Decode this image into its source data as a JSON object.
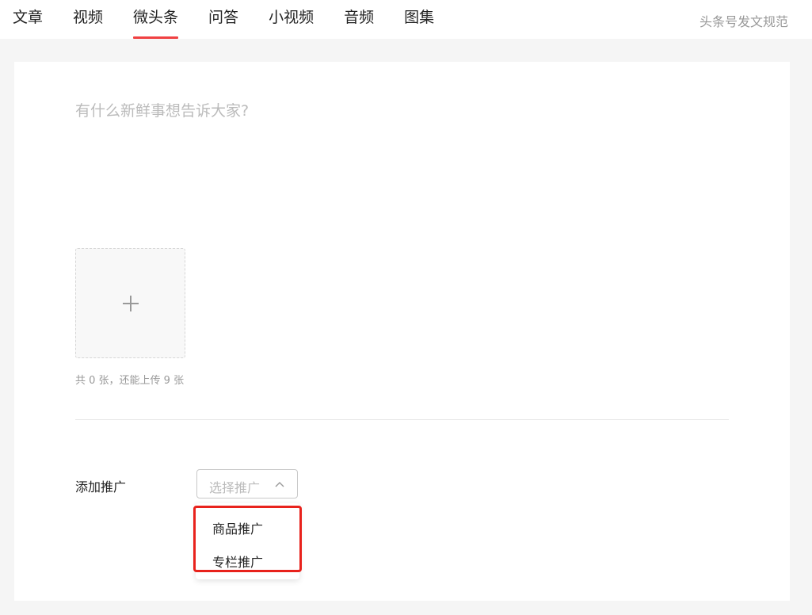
{
  "nav": {
    "tabs": [
      {
        "label": "文章"
      },
      {
        "label": "视频"
      },
      {
        "label": "微头条"
      },
      {
        "label": "问答"
      },
      {
        "label": "小视频"
      },
      {
        "label": "音频"
      },
      {
        "label": "图集"
      }
    ],
    "active_tab": "微头条",
    "guide_link": "头条号发文规范"
  },
  "editor": {
    "placeholder": "有什么新鲜事想告诉大家?"
  },
  "upload": {
    "count_text": "共 0 张，还能上传 9 张"
  },
  "promotion": {
    "label": "添加推广",
    "select_placeholder": "选择推广",
    "options": [
      {
        "label": "商品推广"
      },
      {
        "label": "专栏推广"
      }
    ]
  },
  "colors": {
    "accent": "#f04142",
    "highlight_box": "#e8221c",
    "page_bg": "#f5f5f5"
  }
}
